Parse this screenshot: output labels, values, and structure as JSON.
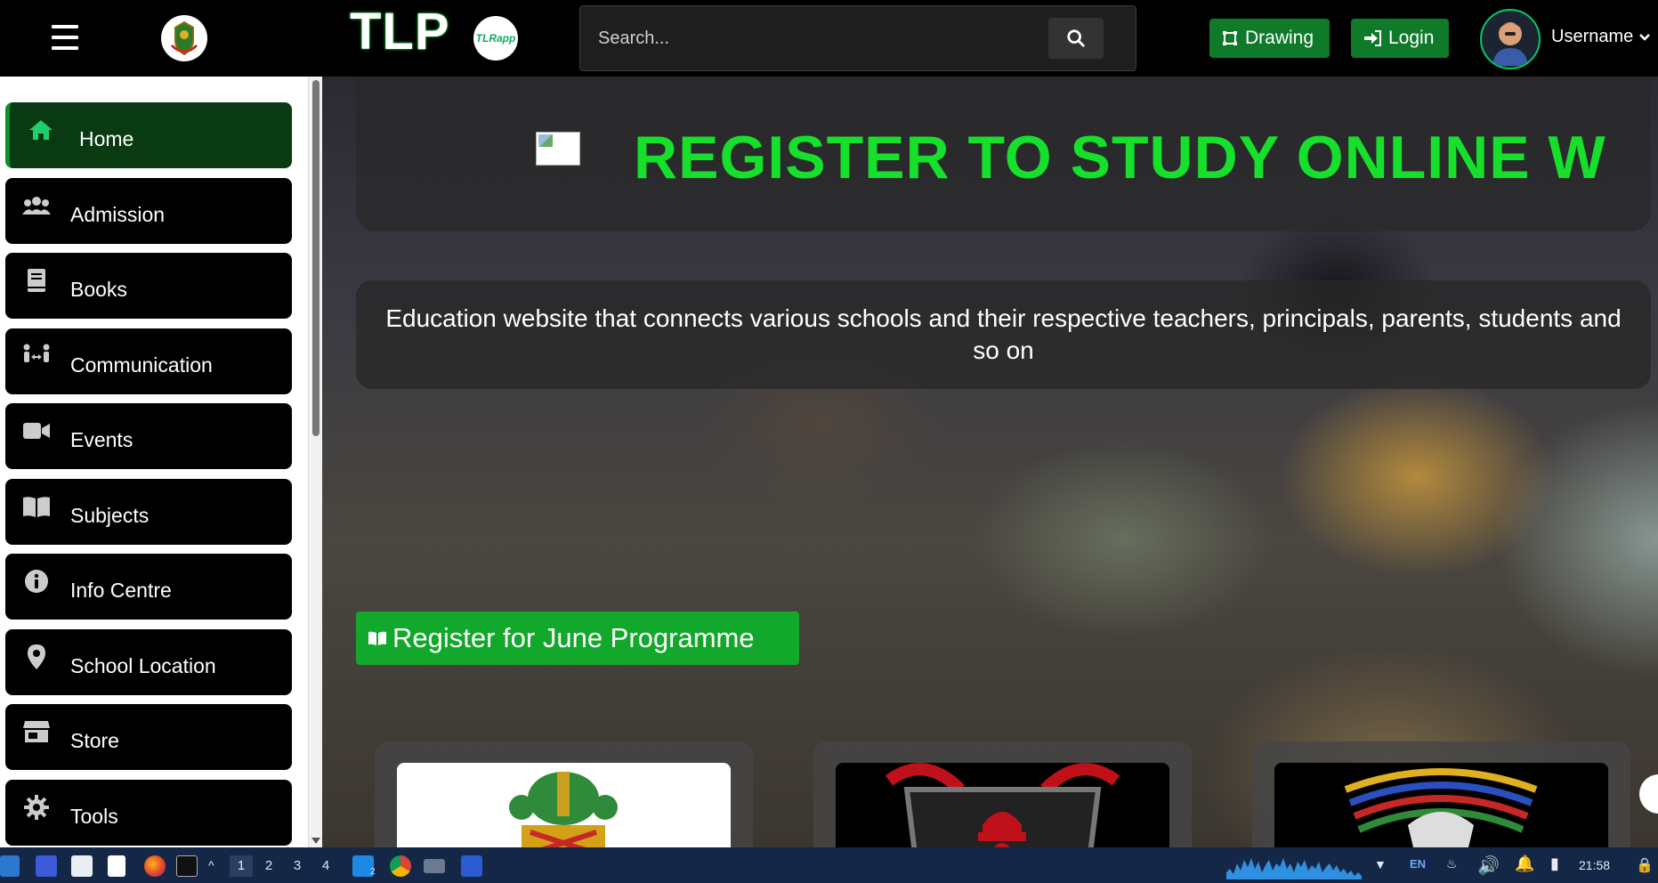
{
  "app": {
    "brand": "TLP",
    "brand_logo_text": "TLRapp"
  },
  "search": {
    "placeholder": "Search..."
  },
  "nav": {
    "drawing_label": "Drawing",
    "login_label": "Login",
    "username": "Username"
  },
  "sidebar": {
    "items": [
      {
        "label": "Home",
        "icon": "home-icon",
        "active": true
      },
      {
        "label": "Admission",
        "icon": "users-icon"
      },
      {
        "label": "Books",
        "icon": "book-icon"
      },
      {
        "label": "Communication",
        "icon": "people-arrows-icon"
      },
      {
        "label": "Events",
        "icon": "video-camera-icon"
      },
      {
        "label": "Subjects",
        "icon": "open-book-icon"
      },
      {
        "label": "Info Centre",
        "icon": "info-icon"
      },
      {
        "label": "School Location",
        "icon": "map-pin-icon"
      },
      {
        "label": "Store",
        "icon": "store-icon"
      },
      {
        "label": "Tools",
        "icon": "gear-icon"
      }
    ]
  },
  "hero": {
    "title": "REGISTER TO STUDY ONLINE W",
    "description": "Education website that connects various schools and their respective teachers, principals, parents, students and so on",
    "register_button": "Register for June Programme"
  },
  "taskbar": {
    "workspaces": [
      "1",
      "2",
      "3",
      "4"
    ],
    "language": "EN",
    "time": "21:58",
    "badge": "2"
  },
  "colors": {
    "accent_green": "#16e02c",
    "button_green": "#12a82b",
    "nav_green": "#0f7a2a",
    "taskbar": "#152746"
  }
}
